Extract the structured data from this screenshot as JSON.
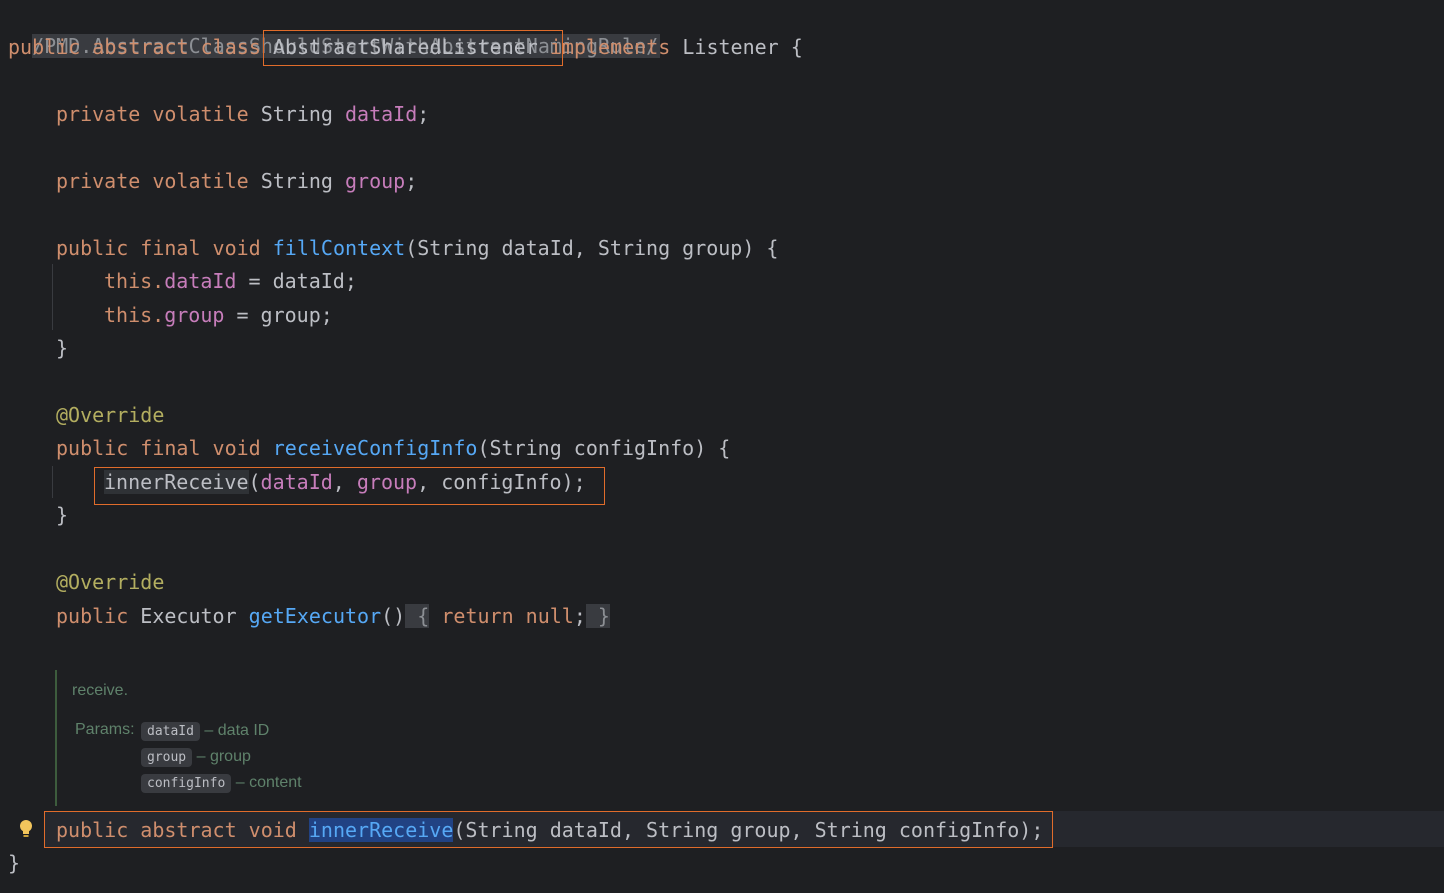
{
  "breadcrumb": "/PMD.AbstractClassShouldStartWithAbstractNamingRule/",
  "code": {
    "class_decl": {
      "kw_public": "public",
      "kw_abstract": "abstract",
      "kw_class": "class",
      "class_name": "AbstractSharedListener",
      "kw_implements": "implements",
      "interface_name": "Listener",
      "open_brace": "{"
    },
    "field1": {
      "mods": "private volatile",
      "type": "String",
      "name": "dataId",
      "end": ";"
    },
    "field2": {
      "mods": "private volatile",
      "type": "String",
      "name": "group",
      "end": ";"
    },
    "fill": {
      "mods": "public final void",
      "name": "fillContext",
      "params": "(String dataId, String group) {",
      "body1_this": "this.",
      "body1_field": "dataId",
      "body1_rest": " = dataId;",
      "body2_this": "this.",
      "body2_field": "group",
      "body2_rest": " = group;",
      "close": "}"
    },
    "receive": {
      "annotation": "@Override",
      "mods": "public final void",
      "name": "receiveConfigInfo",
      "params": "(String configInfo) {",
      "call_name": "innerReceive",
      "call_open": "(",
      "arg1": "dataId",
      "sep1": ", ",
      "arg2": "group",
      "rest": ", configInfo);",
      "close": "}"
    },
    "executor": {
      "annotation": "@Override",
      "kw_public": "public",
      "type": "Executor",
      "name": "getExecutor",
      "parens": "()",
      "fold_open": " {",
      "kw_return": "return",
      "kw_null": "null",
      "semi": ";",
      "fold_close": " }"
    },
    "doc": {
      "description": "receive.",
      "params_label": "Params:",
      "params": [
        {
          "name": "dataId",
          "desc": "– data ID"
        },
        {
          "name": "group",
          "desc": "– group"
        },
        {
          "name": "configInfo",
          "desc": "– content"
        }
      ]
    },
    "abstract_method": {
      "mods": "public abstract void",
      "name": "innerReceive",
      "params": "(String dataId, String group, String configInfo);"
    },
    "class_close": "}"
  },
  "colors": {
    "background": "#1e1f22",
    "keyword": "#cf8e6d",
    "field": "#c77dbb",
    "function": "#56a8f5",
    "annotation": "#b3ae60",
    "highlight_border": "#e06c2b",
    "doc_text": "#5f826b"
  },
  "icons": {
    "intention": "lightbulb-icon"
  }
}
